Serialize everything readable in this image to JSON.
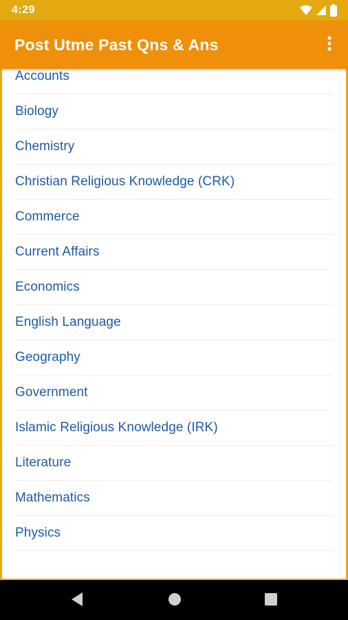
{
  "status_bar": {
    "time": "4:29",
    "icons": [
      "wifi-icon",
      "signal-icon",
      "battery-icon"
    ]
  },
  "app_bar": {
    "title": "Post Utme Past Qns & Ans",
    "menu_icon": "more-vert-icon"
  },
  "subjects": [
    "Accounts",
    "Biology",
    "Chemistry",
    "Christian Religious Knowledge (CRK)",
    "Commerce",
    "Current Affairs",
    "Economics",
    "English Language",
    "Geography",
    "Government",
    "Islamic Religious Knowledge (IRK)",
    "Literature",
    "Mathematics",
    "Physics",
    ""
  ],
  "nav_bar": {
    "icons": [
      "back-icon",
      "home-icon",
      "recents-icon"
    ]
  },
  "colors": {
    "status_bar": "#e3a90f",
    "app_bar": "#ef8f0a",
    "frame": "#e9a911",
    "subject_text": "#1f5aa6"
  }
}
